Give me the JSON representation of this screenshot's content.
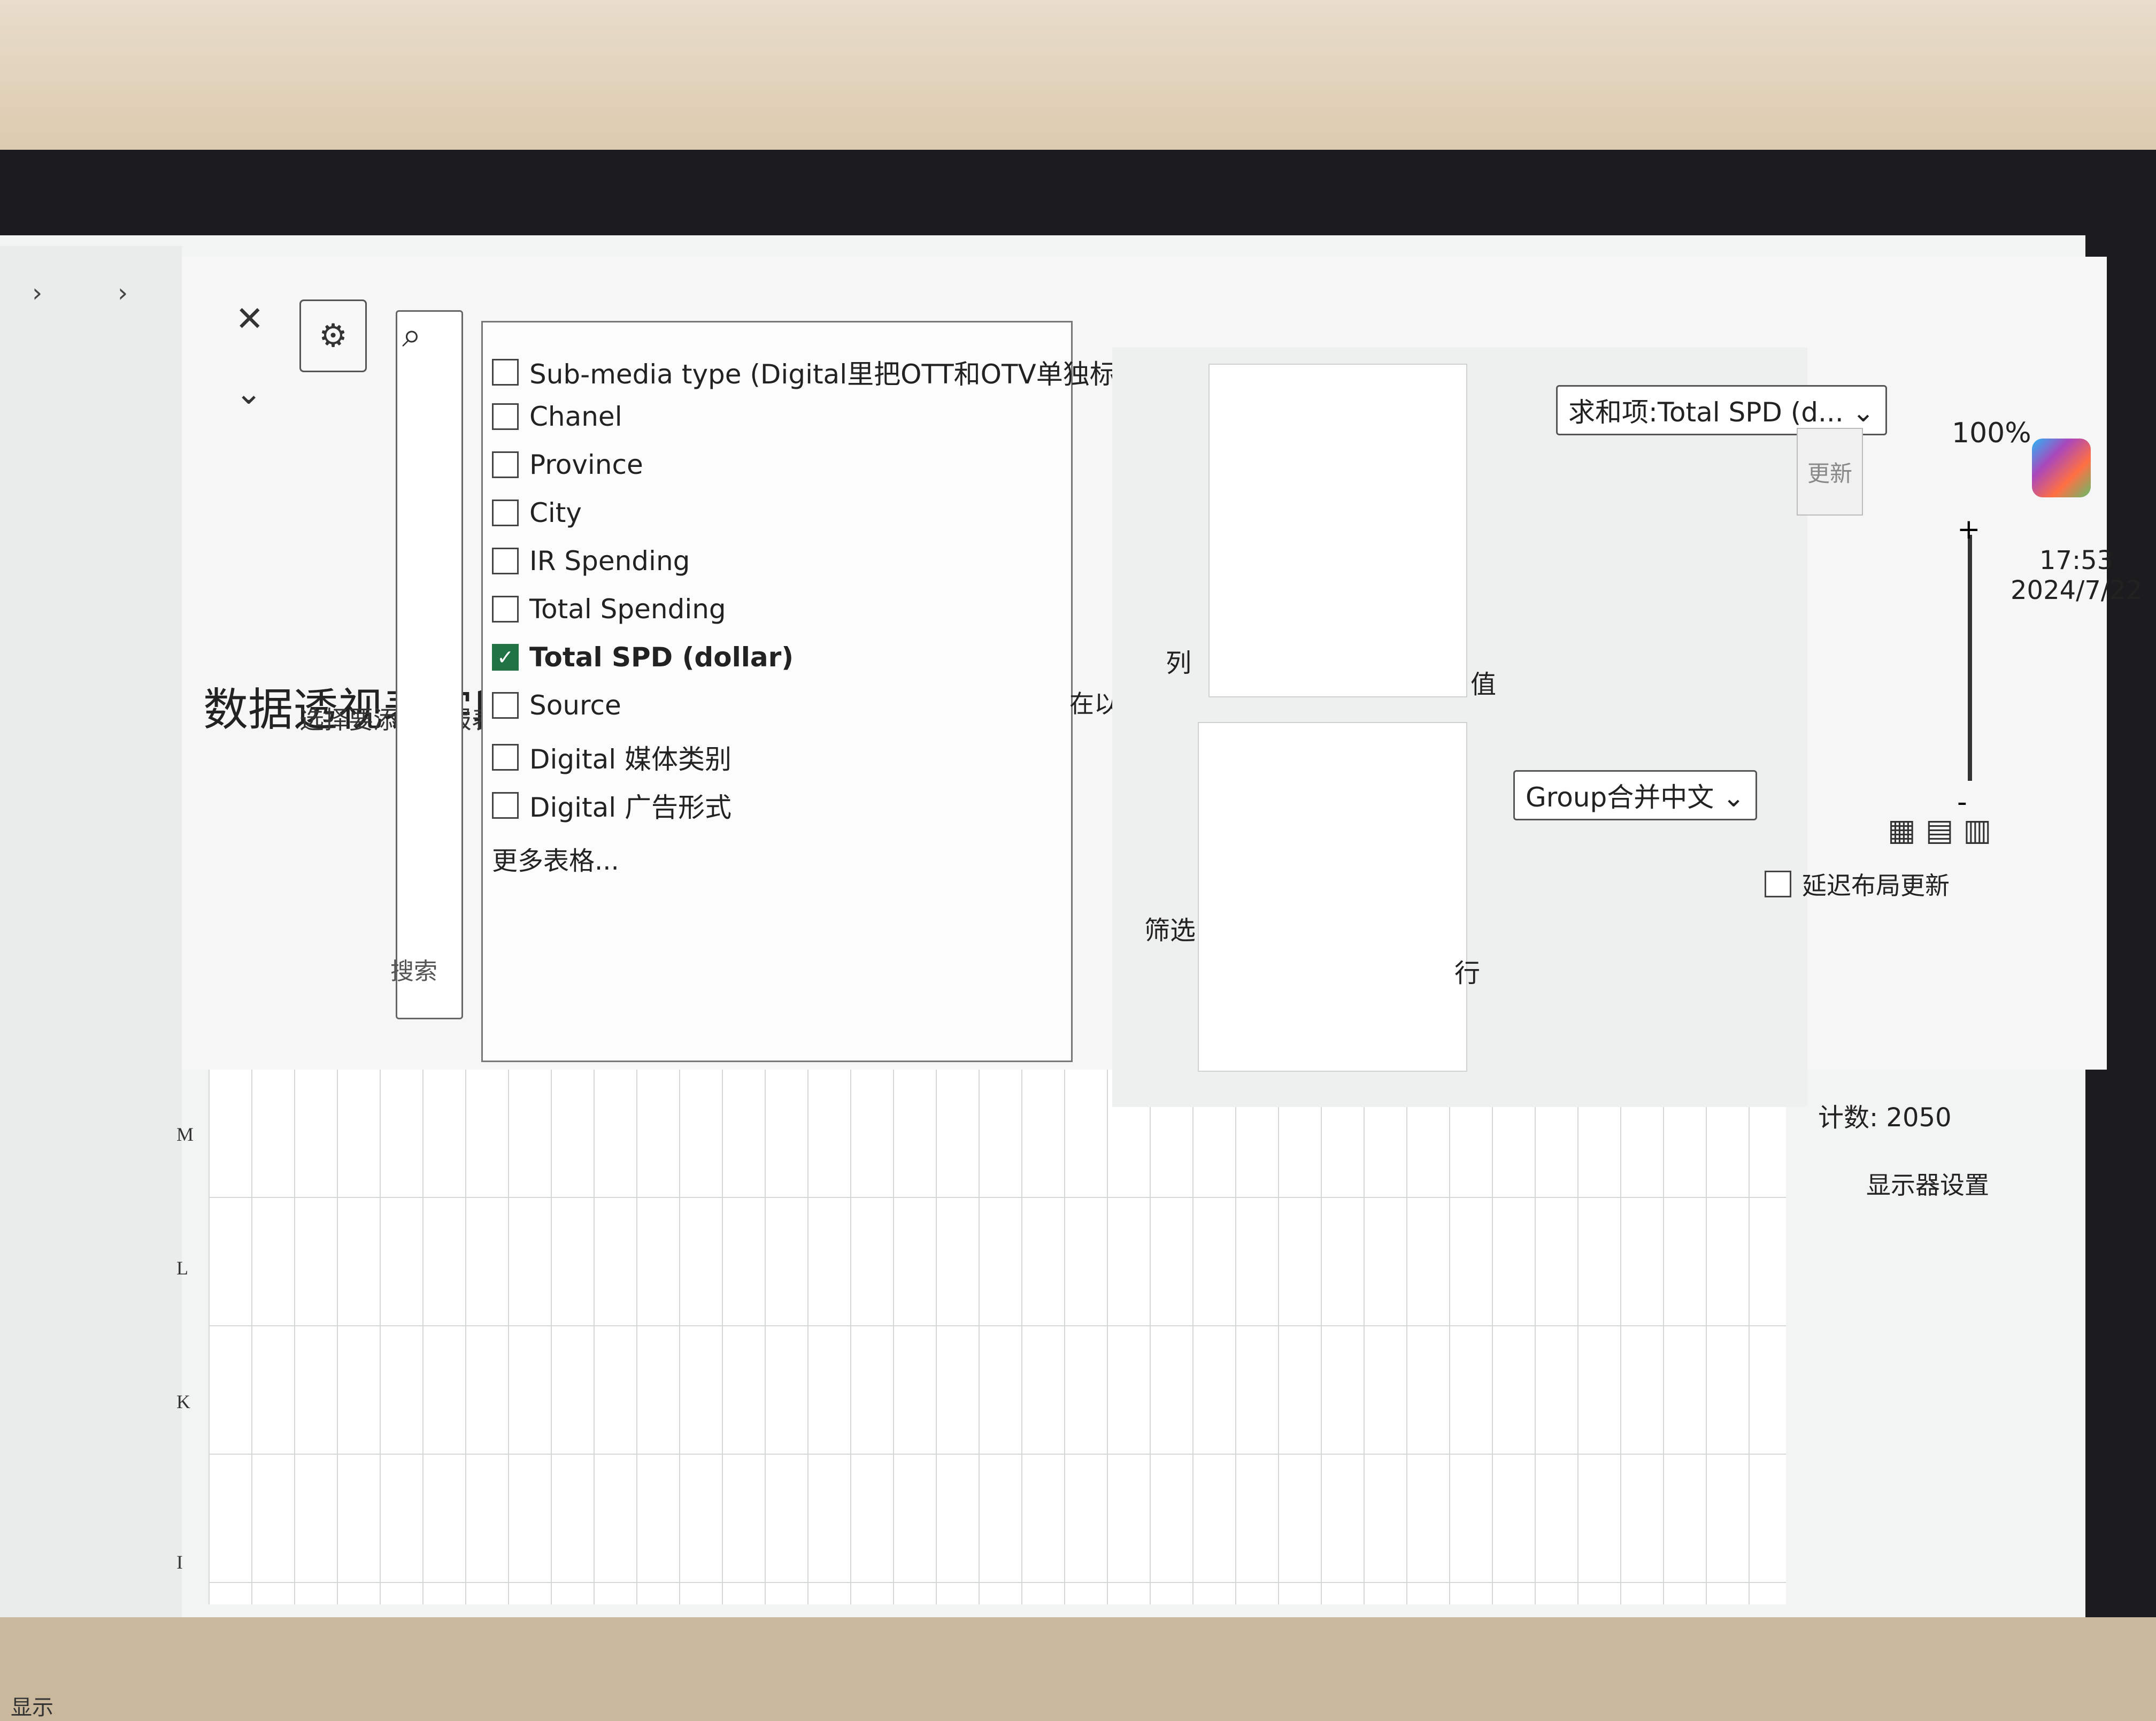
{
  "pane": {
    "title": "数据透视表字段",
    "subtitle": "选择要添加到报表的字段:",
    "search_placeholder": "搜索",
    "fields": [
      {
        "label": "Sub-media type (Digital里把OTT和OTV单独标...",
        "checked": false
      },
      {
        "label": "Chanel",
        "checked": false
      },
      {
        "label": "Province",
        "checked": false
      },
      {
        "label": "City",
        "checked": false
      },
      {
        "label": "IR Spending",
        "checked": false
      },
      {
        "label": "Total Spending",
        "checked": false
      },
      {
        "label": "Total SPD (dollar)",
        "checked": true
      },
      {
        "label": "Source",
        "checked": false
      },
      {
        "label": "Digital 媒体类别",
        "checked": false
      },
      {
        "label": "Digital 广告形式",
        "checked": false
      }
    ],
    "more_tables": "更多表格...",
    "drag_hint": "在以下区域间拖动字段:",
    "areas": {
      "filter_label": "筛选",
      "columns_label": "列",
      "rows_label": "行",
      "values_label": "值",
      "rows_item": "Group合并中文",
      "values_item": "求和项:Total SPD (d..."
    },
    "defer_label": "延迟布局更新",
    "update_label": "更新"
  },
  "sheet": {
    "columns": [
      "I",
      "K",
      "L",
      "M"
    ],
    "show_label": "显示"
  },
  "status": {
    "count": "计数: 2050",
    "display_settings": "显示器设置",
    "zoom": "100%",
    "zoom_minus": "-",
    "zoom_plus": "+"
  },
  "taskbar": {
    "time": "17:53",
    "date": "2024/7/22"
  },
  "colors": {
    "accent": "#217346"
  }
}
